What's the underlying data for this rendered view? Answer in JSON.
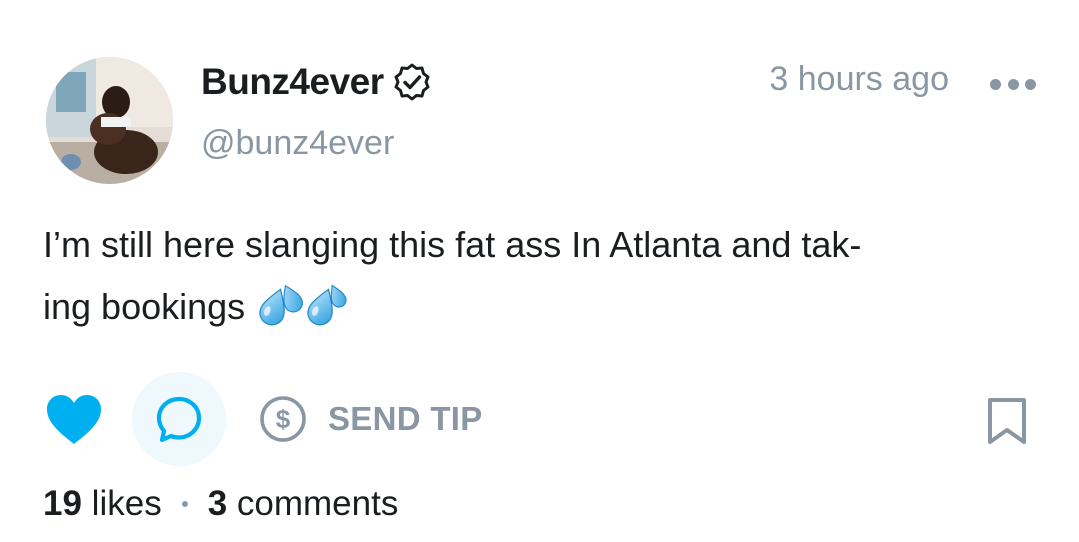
{
  "post": {
    "display_name": "Bunz4ever",
    "handle": "@bunz4ever",
    "timestamp": "3 hours ago",
    "text": "I’m still here slanging this fat ass In Atlanta and tak-ing bookings",
    "text_line1": "I’m still here slanging this fat ass In Atlanta and tak-",
    "text_line2": "ing bookings",
    "emoji": "sweat-droplets-emoji",
    "verified_icon": "verified-badge-icon"
  },
  "actions": {
    "like_icon": "heart-icon",
    "liked": true,
    "comment_icon": "comment-icon",
    "tip_icon": "dollar-circle-icon",
    "tip_label": "SEND TIP",
    "bookmark_icon": "bookmark-icon"
  },
  "stats": {
    "likes_count": "19",
    "likes_label": "likes",
    "comments_count": "3",
    "comments_label": "comments"
  },
  "colors": {
    "accent": "#00aff0",
    "muted": "#8a96a3",
    "text": "#1b1e21",
    "comment_bg": "#eef8fd"
  }
}
